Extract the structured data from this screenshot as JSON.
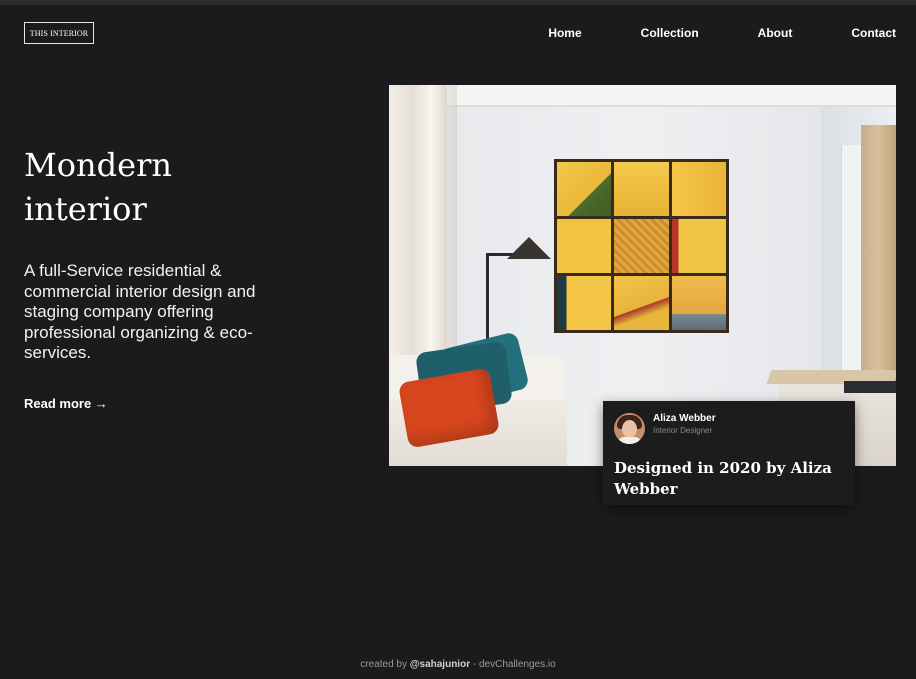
{
  "brand": {
    "logo_text": "THIS INTERIOR"
  },
  "nav": {
    "items": [
      "Home",
      "Collection",
      "About",
      "Contact"
    ]
  },
  "hero": {
    "title_line1": "Mondern",
    "title_line2": "interior",
    "description": "A full-Service residential & commercial interior design and staging company offering professional organizing & eco-services.",
    "read_more": "Read more →"
  },
  "card": {
    "name": "Aliza Webber",
    "role": "Interior Designer",
    "title": "Designed in 2020 by Aliza Webber"
  },
  "footer": {
    "prefix": "created by ",
    "handle": "@sahajunior",
    "suffix": " - devChallenges.io"
  },
  "colors": {
    "background": "#1b1b1d",
    "card": "#1c1c1e",
    "text": "#ffffff",
    "muted": "#8a8a8d"
  }
}
